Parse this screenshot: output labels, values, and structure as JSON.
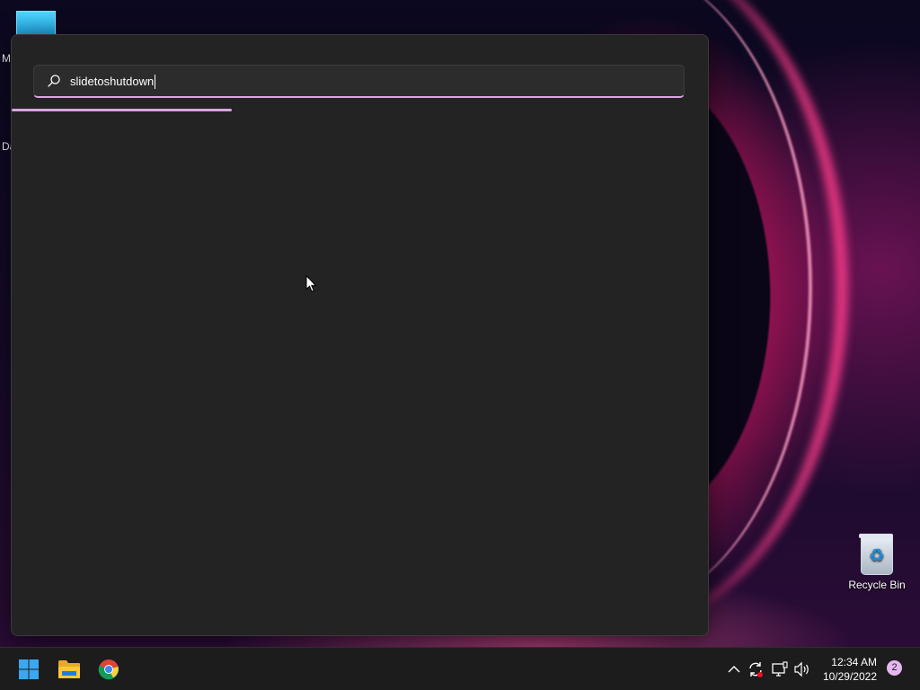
{
  "desktop": {
    "top_letter": "M",
    "mid_letter": "Da",
    "recycle_bin_label": "Recycle Bin"
  },
  "search": {
    "query": "slidetoshutdown",
    "icon": "search-icon",
    "accent": "#d8a5df"
  },
  "taskbar": {
    "apps": [
      {
        "name": "start-button",
        "icon": "windows-logo-icon"
      },
      {
        "name": "file-explorer-button",
        "icon": "folder-icon"
      },
      {
        "name": "chrome-button",
        "icon": "chrome-icon"
      }
    ],
    "tray_icons": [
      "chevron-up-icon",
      "sync-icon",
      "network-icon",
      "volume-icon"
    ],
    "time": "12:34 AM",
    "date": "10/29/2022",
    "notification_count": "2"
  }
}
